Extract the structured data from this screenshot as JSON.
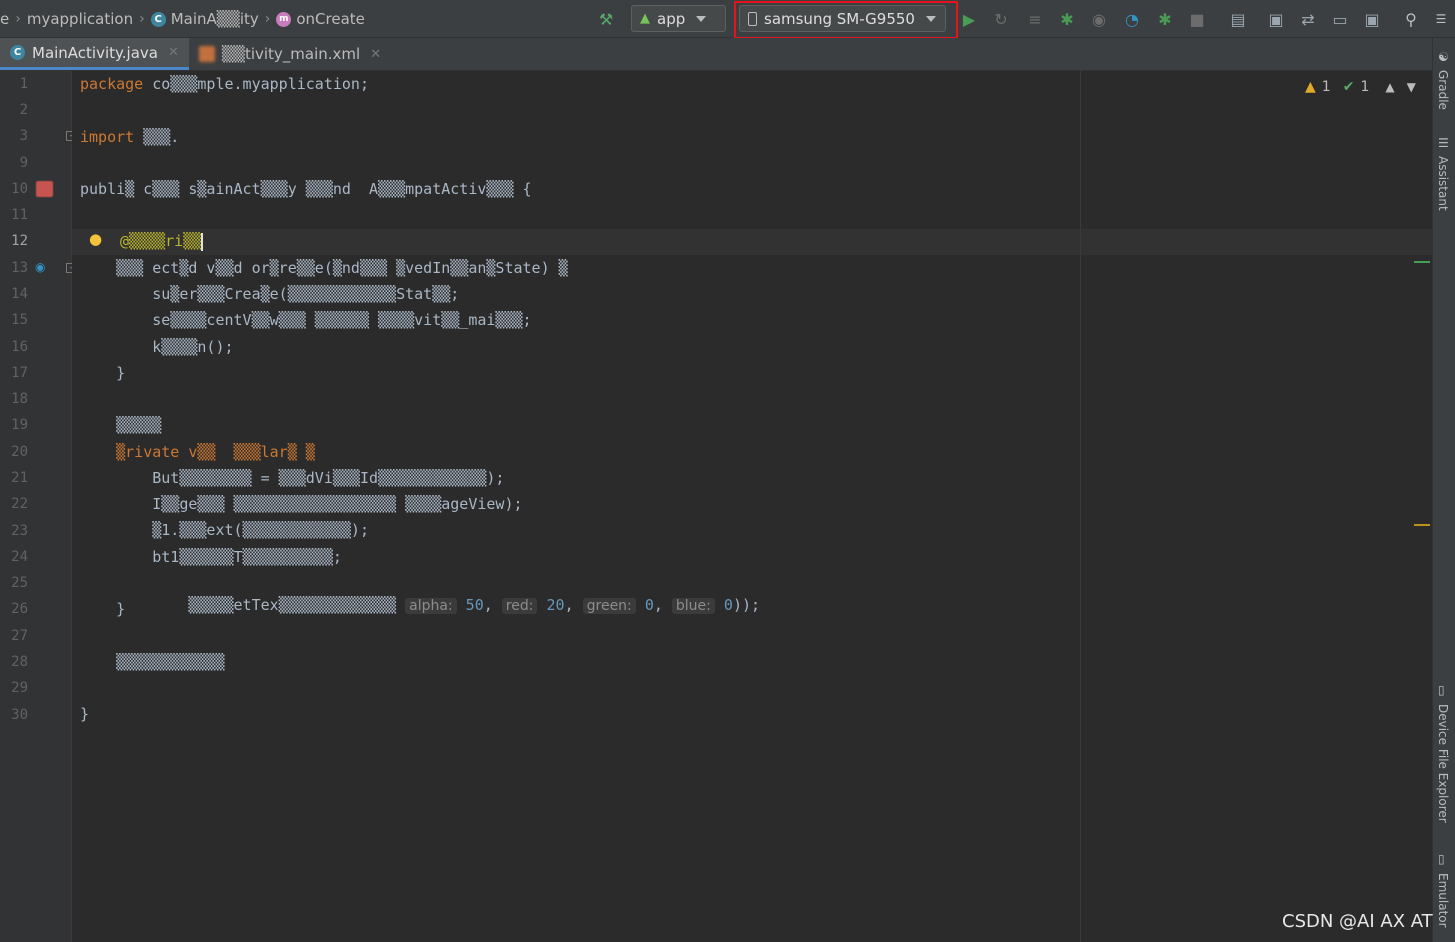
{
  "navbar": {
    "crumbs": [
      "e",
      "myapplication",
      "MainA▒▒ity",
      "onCreate"
    ],
    "run_config": "app",
    "device": "samsung SM-G9550"
  },
  "tabs": [
    "MainActivity.java",
    "▒▒tivity_main.xml"
  ],
  "gutter": {
    "line_numbers": [
      "1",
      "2",
      "3",
      "9",
      "10",
      "11",
      "12",
      "13",
      "14",
      "15",
      "16",
      "17",
      "18",
      "19",
      "20",
      "21",
      "22",
      "23",
      "24",
      "25",
      "26",
      "27",
      "28",
      "29",
      "30"
    ]
  },
  "code": {
    "l1_kw": "package",
    "l1_rest": " co▒▒▒mple.myapplication;",
    "l3_kw": "import",
    "l3_rest": " ▒▒▒.",
    "l10_a": "publi▒ c▒▒▒ s▒ainAct▒▒▒y ▒▒▒nd  A▒▒▒mpatActiv▒▒▒ {",
    "l12": "@▒▒▒▒ri▒▒",
    "l13": "    ▒▒▒ ect▒d v▒▒d or▒re▒▒e(▒nd▒▒▒ ▒vedIn▒▒an▒State) ▒",
    "l14": "        su▒er▒▒▒Crea▒e(▒▒▒▒▒▒▒▒▒▒▒▒Stat▒▒;",
    "l15": "        se▒▒▒▒centV▒▒w▒▒▒ ▒▒▒▒▒▒ ▒▒▒▒vit▒▒_mai▒▒▒;",
    "l16": "        k▒▒▒▒n();",
    "l17": "    }",
    "l19": "    ▒▒▒▒▒",
    "l20": "    ▒rivate v▒▒  ▒▒▒lar▒ ▒",
    "l21": "        But▒▒▒▒▒▒▒▒ = ▒▒▒dVi▒▒▒Id▒▒▒▒▒▒▒▒▒▒▒▒);",
    "l22": "        I▒▒ge▒▒▒ ▒▒▒▒▒▒▒▒▒▒▒▒▒▒▒▒▒▒ ▒▒▒▒ageView);",
    "l23": "        ▒1.▒▒▒ext(▒▒▒▒▒▒▒▒▒▒▒▒);",
    "l24": "        bt1▒▒▒▒▒▒T▒▒▒▒▒▒▒▒▒▒;",
    "l25_pre": "        ▒▒▒▒▒etTex▒▒▒▒▒▒▒▒▒▒▒▒▒ ",
    "hint_alpha": "alpha:",
    "v_alpha": "50",
    "hint_red": "red:",
    "v_red": "20",
    "hint_green": "green:",
    "v_green": "0",
    "hint_blue": "blue:",
    "v_blue": "0",
    "l26": "    }",
    "l28": "    ▒▒▒▒▒▒▒▒▒▒▒▒",
    "l30": "}"
  },
  "inspections": {
    "warnings": "1",
    "ok": "1"
  },
  "right_tools": [
    "Gradle",
    "Assistant",
    "Device File Explorer",
    "Emulator"
  ],
  "watermark": "CSDN @AI  AX  AT"
}
